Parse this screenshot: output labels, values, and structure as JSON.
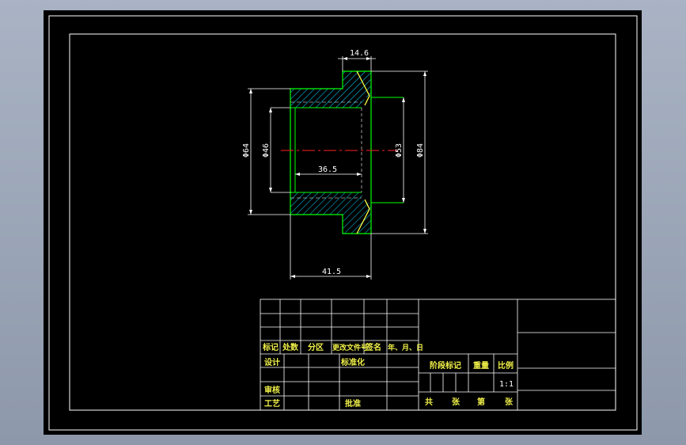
{
  "drawing": {
    "dimensions": {
      "d_14_6": "14.6",
      "d_36_5": "36.5",
      "d_41_5": "41.5",
      "d_phi64": "Φ64",
      "d_phi46": "Φ46",
      "d_phi53": "Φ53",
      "d_phi84": "Φ84"
    }
  },
  "title_block": {
    "row_labels": {
      "biaoji": "标记",
      "chushu": "处数",
      "fenqu": "分区",
      "gengai": "更改文件号",
      "qianming": "签名",
      "nianyueri": "年、月、日"
    },
    "sheji": "设计",
    "biaozhunhua": "标准化",
    "shenhe": "审核",
    "gongyi": "工艺",
    "pizhun": "批准",
    "jieduan": "阶段标记",
    "zhongliang": "重量",
    "bili": "比例",
    "scale_value": "1:1",
    "gong": "共",
    "zhang1": "张",
    "di": "第",
    "zhang2": "张"
  },
  "colors": {
    "frame": "#ffffff",
    "outline": "#00ff00",
    "hatch": "#00ffff",
    "center": "#ff2020",
    "edge": "#ffff40",
    "text": "#ffff40"
  }
}
